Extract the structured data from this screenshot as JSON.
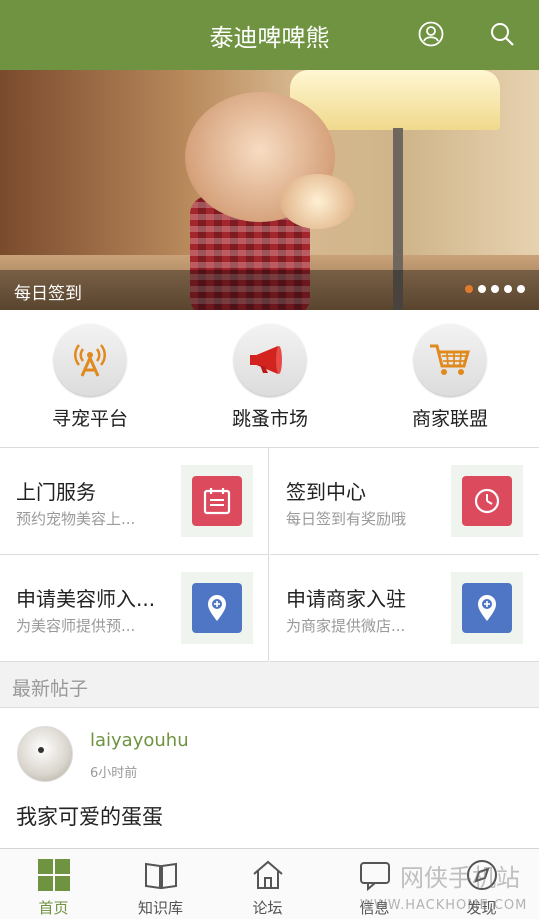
{
  "header": {
    "title": "泰迪啤啤熊",
    "user_icon": "user-icon",
    "search_icon": "search-icon",
    "color": "#6f9340"
  },
  "banner": {
    "caption": "每日签到",
    "dots_total": 5,
    "active_dot": 1,
    "active_color": "#e07a2e"
  },
  "categories": [
    {
      "label": "寻宠平台",
      "icon": "radio-tower-icon"
    },
    {
      "label": "跳蚤市场",
      "icon": "megaphone-icon"
    },
    {
      "label": "商家联盟",
      "icon": "shopping-cart-icon"
    }
  ],
  "services": [
    {
      "title": "上门服务",
      "subtitle": "预约宠物美容上...",
      "icon": "calendar-icon",
      "color": "#dc4a5e"
    },
    {
      "title": "签到中心",
      "subtitle": "每日签到有奖励哦",
      "icon": "clock-icon",
      "color": "#dc4a5e"
    },
    {
      "title": "申请美容师入...",
      "subtitle": "为美容师提供预...",
      "icon": "location-pin-icon",
      "color": "#4f76c4"
    },
    {
      "title": "申请商家入驻",
      "subtitle": "为商家提供微店...",
      "icon": "location-pin-icon",
      "color": "#4f76c4"
    }
  ],
  "latest": {
    "section_title": "最新帖子",
    "post": {
      "username": "laiyayouhu",
      "time": "6小时前",
      "content": "我家可爱的蛋蛋"
    }
  },
  "tabs": [
    {
      "label": "首页",
      "icon": "home-grid-icon",
      "active": true
    },
    {
      "label": "知识库",
      "icon": "book-icon",
      "active": false
    },
    {
      "label": "论坛",
      "icon": "house-icon",
      "active": false
    },
    {
      "label": "信息",
      "icon": "message-icon",
      "active": false
    },
    {
      "label": "发现",
      "icon": "compass-icon",
      "active": false
    }
  ],
  "watermark": {
    "main": "网侠手机站",
    "sub": "WWW.HACKHOME.COM"
  }
}
